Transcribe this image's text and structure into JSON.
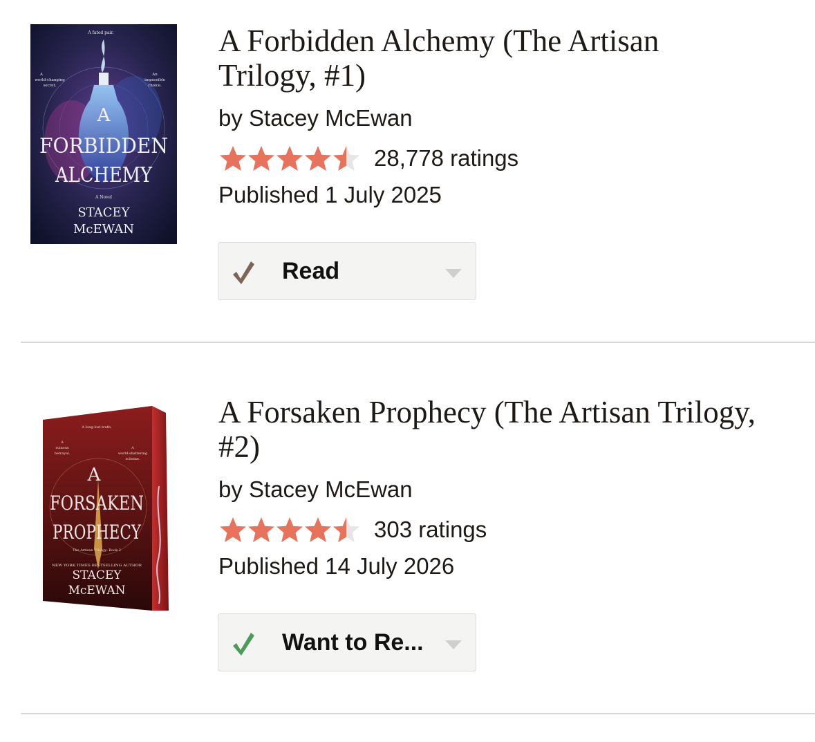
{
  "colors": {
    "star_filled": "#e7735d",
    "star_empty": "#e6e6e6",
    "check_read": "#7b655a",
    "check_want": "#4d9a5d",
    "divider": "#d8d8d6"
  },
  "books": [
    {
      "title": "A Forbidden Alchemy (The Artisan Trilogy, #1)",
      "author": "by Stacey McEwan",
      "rating": 4.5,
      "ratings_count": "28,778 ratings",
      "published": "Published 1 July 2025",
      "shelf": {
        "label": "Read",
        "icon": "check-icon"
      },
      "cover": {
        "tagline_top": "A fated pair.",
        "tagline_left_1": "A",
        "tagline_left_2": "world-changing",
        "tagline_left_3": "secret.",
        "tagline_right_1": "An",
        "tagline_right_2": "impossible",
        "tagline_right_3": "choice.",
        "title_line_1": "A",
        "title_line_2": "FORBIDDEN",
        "title_line_3": "ALCHEMY",
        "subtitle": "A Novel",
        "author_line_1": "STACEY",
        "author_line_2": "McEWAN"
      }
    },
    {
      "title": "A Forsaken Prophecy (The Artisan Trilogy, #2)",
      "author": "by Stacey McEwan",
      "rating": 4.5,
      "ratings_count": "303 ratings",
      "published": "Published 14 July 2026",
      "shelf": {
        "label": "Want to Re...",
        "icon": "check-icon"
      },
      "cover": {
        "tagline_top": "A long-lost truth.",
        "tagline_left_1": "A",
        "tagline_left_2": "ruinous",
        "tagline_left_3": "betrayal.",
        "tagline_right_1": "A",
        "tagline_right_2": "world-shattering",
        "tagline_right_3": "scheme.",
        "title_line_1": "A",
        "title_line_2": "FORSAKEN",
        "title_line_3": "PROPHECY",
        "subtitle": "The Artisan Trilogy: Book 2",
        "author_banner": "NEW YORK TIMES BESTSELLING AUTHOR",
        "author_line_1": "STACEY",
        "author_line_2": "McEWAN"
      }
    }
  ]
}
